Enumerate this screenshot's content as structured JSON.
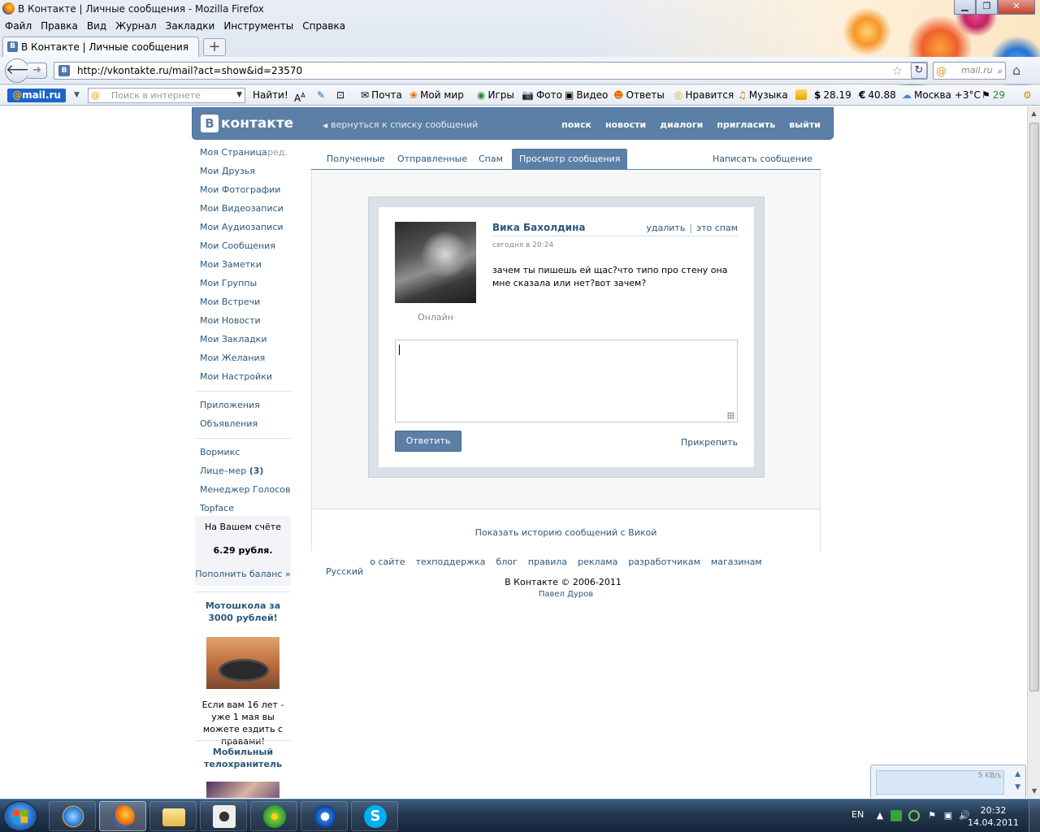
{
  "browser": {
    "window_title": "В Контакте | Личные сообщения - Mozilla Firefox",
    "menu": [
      "Файл",
      "Правка",
      "Вид",
      "Журнал",
      "Закладки",
      "Инструменты",
      "Справка"
    ],
    "tab_title": "В Контакте | Личные сообщения",
    "url": "http://vkontakte.ru/mail?act=show&id=23570",
    "search_placeholder": "mail.ru",
    "favicon_letter": "B"
  },
  "mailru_bar": {
    "logo_at": "@",
    "logo_text": "mail.ru",
    "search_placeholder": "Поиск в интернете",
    "find_button": "Найти!",
    "items": {
      "mail": "Почта",
      "myworld": "Мой мир",
      "games": "Игры",
      "photo": "Фото",
      "video": "Видео",
      "answers": "Ответы",
      "like": "Нравится",
      "music": "Музыка",
      "usd": "28.19",
      "eur": "40.88",
      "weather": "Москва +3°C",
      "traffic": "29"
    },
    "usd_symbol": "$",
    "eur_symbol": "€"
  },
  "vk": {
    "logo_letter": "B",
    "logo_text": "контакте",
    "back_link": "вернуться к списку сообщений",
    "top_nav": [
      "поиск",
      "новости",
      "диалоги",
      "пригласить",
      "выйти"
    ],
    "left_menu": {
      "my_page": "Моя Страница",
      "edit": "ред.",
      "friends": "Мои Друзья",
      "photos": "Мои Фотографии",
      "videos": "Мои Видеозаписи",
      "audio": "Мои Аудиозаписи",
      "messages": "Мои Сообщения",
      "notes": "Мои Заметки",
      "groups": "Мои Группы",
      "events": "Мои Встречи",
      "news": "Мои Новости",
      "bookmarks": "Мои Закладки",
      "wishes": "Мои Желания",
      "settings": "Мои Настройки",
      "apps": "Приложения",
      "ads": "Объявления",
      "wormix": "Вормикс",
      "facemeasure": "Лице–мер",
      "facemeasure_count": "(3)",
      "voices": "Менеджер Голосов",
      "topface": "Topface"
    },
    "balance": {
      "title": "На Вашем счёте",
      "amount": "6.29 рубля.",
      "topup": "Пополнить баланс »"
    },
    "ads": [
      {
        "title": "Мотошкола за 3000 рублей!",
        "text": "Если вам 16 лет - уже 1 мая вы можете ездить с правами!"
      },
      {
        "title": "Мобильный телохранитель"
      }
    ],
    "tabs": {
      "inbox": "Полученные",
      "sent": "Отправленные",
      "spam": "Спам",
      "view": "Просмотр сообщения",
      "write": "Написать сообщение"
    },
    "message": {
      "sender": "Вика Бахолдина",
      "delete": "удалить",
      "separator": "|",
      "spam": "это спам",
      "date": "сегодня в 20:24",
      "text": "зачем ты пишешь ей щас?что типо про стену она мне сказала или нет?вот зачем?",
      "online": "Онлайн",
      "reply_button": "Ответить",
      "attach": "Прикрепить",
      "history": "Показать историю сообщений с Викой"
    },
    "footer": {
      "links": [
        "о сайте",
        "техподдержка",
        "блог",
        "правила",
        "реклама",
        "разработчикам",
        "магазинам"
      ],
      "copyright": "В Контакте © 2006-2011",
      "language": "Русский",
      "author": "Павел Дуров"
    }
  },
  "download_popup": {
    "speed": "5 KB/s"
  },
  "taskbar": {
    "lang": "EN",
    "time": "20:32",
    "date": "14.04.2011"
  }
}
